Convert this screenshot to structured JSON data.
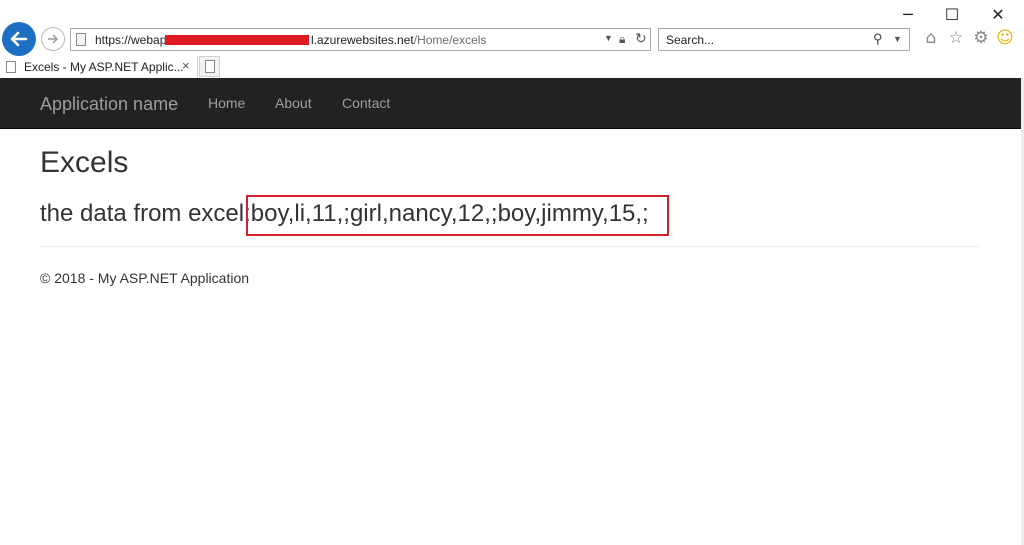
{
  "browser": {
    "url_prefix": "https://webap",
    "url_domain": "l.azurewebsites.net",
    "url_path": "/Home/excels",
    "search_placeholder": "Search...",
    "tab_title": "Excels - My ASP.NET Applic...",
    "tab_close": "×"
  },
  "icons": {
    "back": "back-arrow-icon",
    "forward": "forward-arrow-icon",
    "home": "home-icon",
    "favorites": "star-icon",
    "settings": "gear-icon",
    "feedback": "smiley-icon"
  },
  "navbar": {
    "brand": "Application name",
    "links": [
      "Home",
      "About",
      "Contact"
    ]
  },
  "main": {
    "title": "Excels",
    "data_label": "the data from excel:",
    "data_value": "boy,li,11,;girl,nancy,12,;boy,jimmy,15,;"
  },
  "footer": {
    "text": "© 2018 - My ASP.NET Application"
  },
  "colors": {
    "navbar_bg": "#222222",
    "nav_text": "#9d9d9d",
    "highlight_border": "#d0202a",
    "redaction": "#e01b24",
    "back_button": "#1c6fc2"
  }
}
